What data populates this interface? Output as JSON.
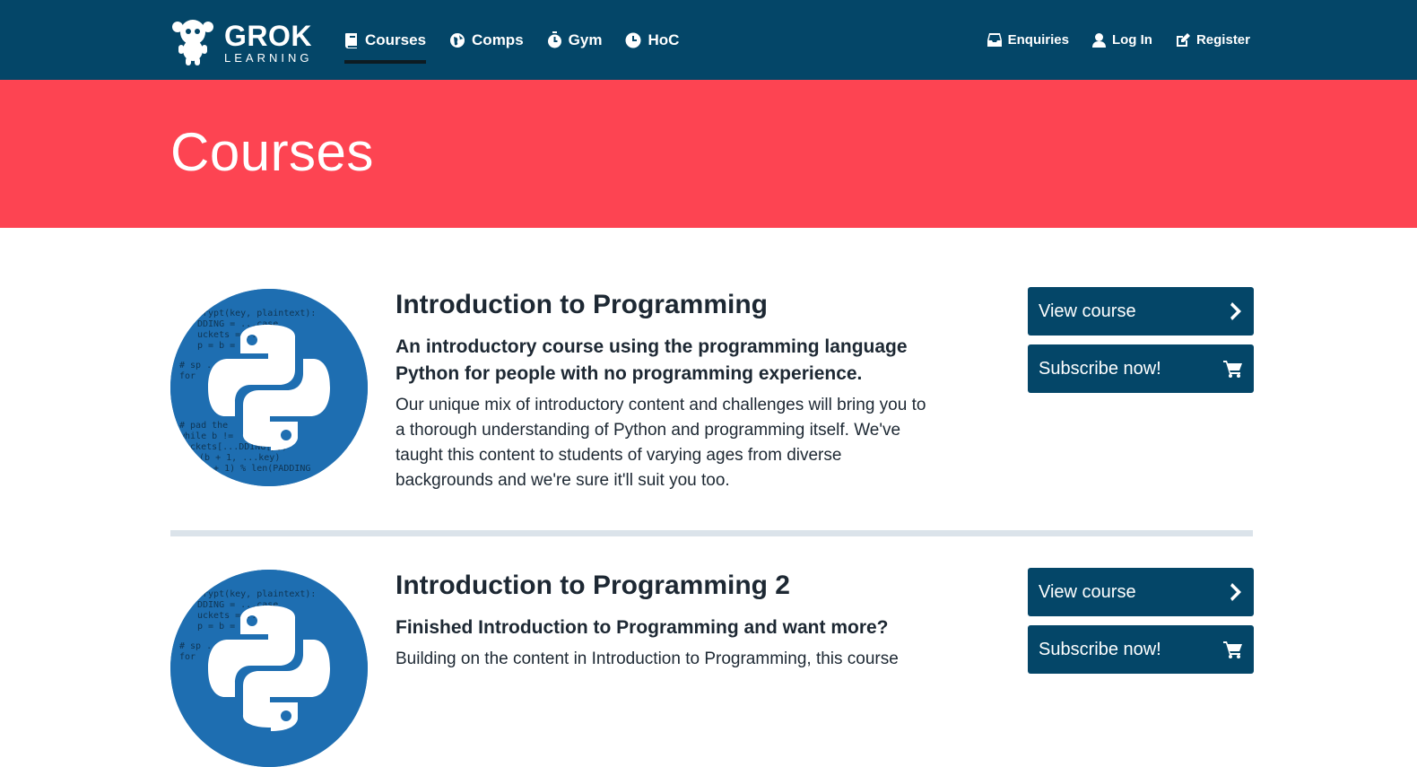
{
  "logo": {
    "brand": "GROK",
    "tagline": "LEARNING"
  },
  "nav": {
    "left": [
      {
        "label": "Courses",
        "icon": "book-icon",
        "active": true
      },
      {
        "label": "Comps",
        "icon": "globe-icon"
      },
      {
        "label": "Gym",
        "icon": "stopwatch-icon"
      },
      {
        "label": "HoC",
        "icon": "clock-icon"
      }
    ],
    "right": [
      {
        "label": "Enquiries",
        "icon": "inbox-icon"
      },
      {
        "label": "Log In",
        "icon": "user-icon"
      },
      {
        "label": "Register",
        "icon": "edit-icon"
      }
    ]
  },
  "hero": {
    "title": "Courses"
  },
  "courses": [
    {
      "title": "Introduction to Programming",
      "subtitle": "An introductory course using the programming language Python for people with no programming experience.",
      "description": "Our unique mix of introductory content and challenges will bring you to a thorough understanding of Python and programming itself. We've taught this content to students of varying ages from diverse backgrounds and we're sure it'll suit you too.",
      "view_label": "View course",
      "subscribe_label": "Subscribe now!"
    },
    {
      "title": "Introduction to Programming 2",
      "subtitle": "Finished Introduction to Programming and want more?",
      "description": "Building on the content in Introduction to Programming, this course",
      "view_label": "View course",
      "subscribe_label": "Subscribe now!"
    }
  ],
  "code_snippet": [
    "crypt(key, plaintext):",
    "DDING = ...case",
    "uckets = ...key]",
    "p = b = 0",
    "# sp ...text",
    "for",
    "# pad the",
    "while b !=",
    "buckets[...DDING[p])",
    "= (b + 1, ...key)",
    "(p + 1) % len(PADDING"
  ],
  "colors": {
    "navbar": "#044668",
    "hero": "#fd4452",
    "button": "#044668",
    "divider": "#dbe3ea",
    "python_blue": "#1e6eb1"
  }
}
